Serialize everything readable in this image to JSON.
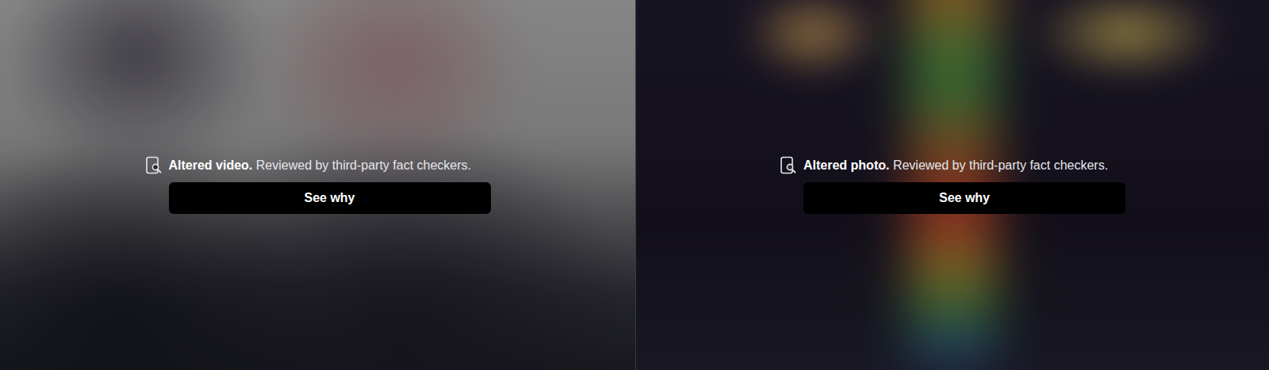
{
  "panels": [
    {
      "kind": "video",
      "label": "Altered video.",
      "note": "Reviewed by third-party fact checkers.",
      "button": "See why"
    },
    {
      "kind": "photo",
      "label": "Altered photo.",
      "note": "Reviewed by third-party fact checkers.",
      "button": "See why"
    }
  ]
}
